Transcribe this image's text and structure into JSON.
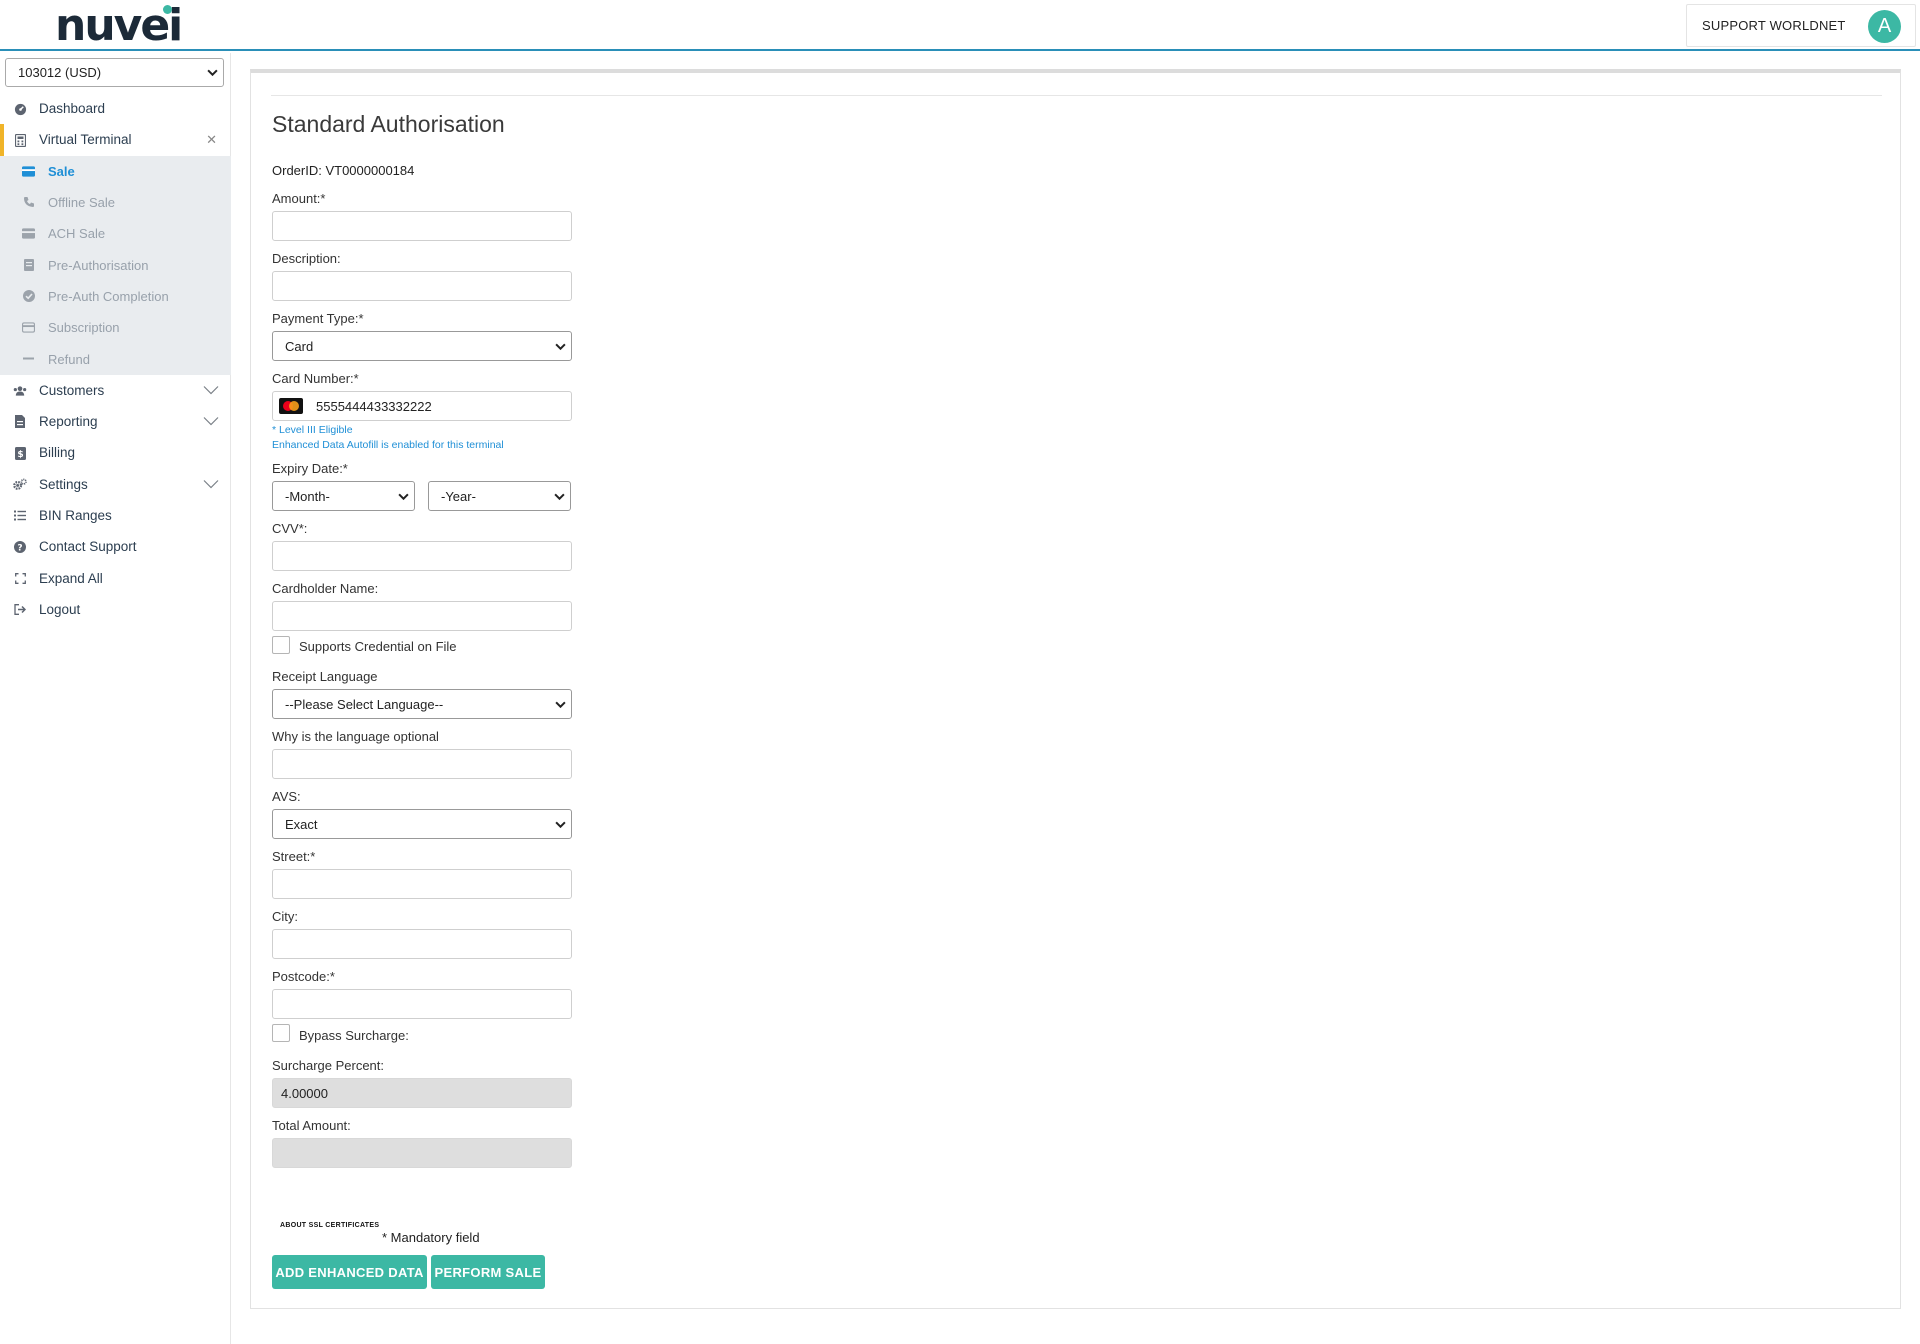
{
  "header": {
    "logo_text": "nuvei",
    "user_name": "SUPPORT WORLDNET",
    "avatar_initial": "A",
    "accent": "#3cb8a4"
  },
  "sidebar": {
    "account": "103012 (USD)",
    "items": [
      {
        "label": "Dashboard",
        "icon": "dashboard-icon"
      },
      {
        "label": "Virtual Terminal",
        "icon": "calculator-icon"
      },
      {
        "label": "Customers",
        "icon": "users-icon"
      },
      {
        "label": "Reporting",
        "icon": "document-icon"
      },
      {
        "label": "Billing",
        "icon": "dollar-icon"
      },
      {
        "label": "Settings",
        "icon": "gears-icon"
      },
      {
        "label": "BIN Ranges",
        "icon": "list-icon"
      },
      {
        "label": "Contact Support",
        "icon": "question-icon"
      },
      {
        "label": "Expand All",
        "icon": "expand-icon"
      },
      {
        "label": "Logout",
        "icon": "logout-icon"
      }
    ],
    "sub_items": [
      {
        "label": "Sale",
        "icon": "card-icon"
      },
      {
        "label": "Offline Sale",
        "icon": "phone-icon"
      },
      {
        "label": "ACH Sale",
        "icon": "card-icon"
      },
      {
        "label": "Pre-Authorisation",
        "icon": "receipt-icon"
      },
      {
        "label": "Pre-Auth Completion",
        "icon": "check-circle-icon"
      },
      {
        "label": "Subscription",
        "icon": "card-icon"
      },
      {
        "label": "Refund",
        "icon": "minus-icon"
      }
    ]
  },
  "form": {
    "title": "Standard Authorisation",
    "order_id": "OrderID: VT0000000184",
    "amount_label": "Amount:*",
    "amount_value": "",
    "description_label": "Description:",
    "description_value": "",
    "payment_type_label": "Payment Type:*",
    "payment_type_value": "Card",
    "card_number_label": "Card Number:*",
    "card_number_value": "5555444433332222",
    "level3_hint": "* Level III Eligible",
    "autofill_hint": "Enhanced Data Autofill is enabled for this terminal",
    "expiry_label": "Expiry Date:*",
    "expiry_month": "-Month-",
    "expiry_year": "-Year-",
    "cvv_label": "CVV*:",
    "cardholder_label": "Cardholder Name:",
    "credential_label": "Supports Credential on File",
    "receipt_language_label": "Receipt Language",
    "receipt_language_value": "--Please Select Language--",
    "why_language_label": "Why is the language optional",
    "avs_label": "AVS:",
    "avs_value": "Exact",
    "street_label": "Street:*",
    "city_label": "City:",
    "postcode_label": "Postcode:*",
    "bypass_label": "Bypass Surcharge:",
    "surcharge_label": "Surcharge Percent:",
    "surcharge_value": "4.00000",
    "total_label": "Total Amount:",
    "total_value": "",
    "ssl_text": "ABOUT SSL CERTIFICATES",
    "mandatory_text": "* Mandatory field",
    "enhanced_button": "ADD ENHANCED DATA",
    "perform_button": "PERFORM SALE"
  }
}
